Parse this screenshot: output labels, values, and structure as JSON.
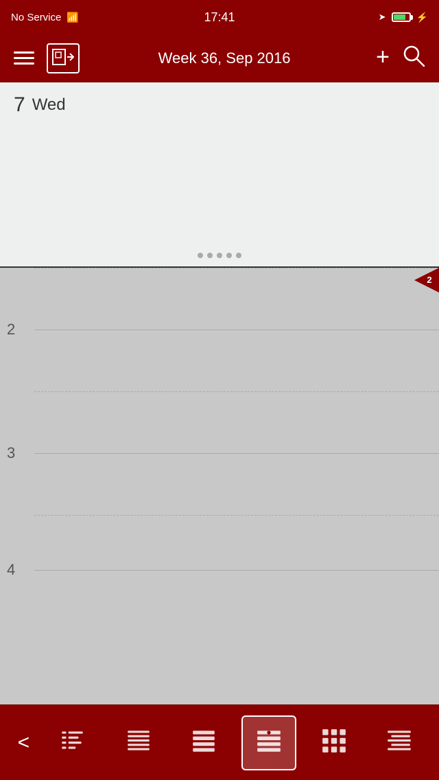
{
  "statusBar": {
    "carrier": "No Service",
    "time": "17:41"
  },
  "toolbar": {
    "weekLabel": "Week 36, Sep 2016",
    "addLabel": "+",
    "searchLabel": "🔍"
  },
  "allDay": {
    "dayNumber": "7",
    "dayName": "Wed"
  },
  "timeline": {
    "hours": [
      {
        "id": "hour-2",
        "label": "2"
      },
      {
        "id": "hour-3",
        "label": "3"
      },
      {
        "id": "hour-4",
        "label": "4"
      }
    ],
    "currentIndicator": "2"
  },
  "tabBar": {
    "backLabel": "<",
    "tabs": [
      {
        "id": "tab-timeline",
        "label": "Timeline"
      },
      {
        "id": "tab-list-compact",
        "label": "List Compact"
      },
      {
        "id": "tab-list",
        "label": "List"
      },
      {
        "id": "tab-week",
        "label": "Week",
        "active": true
      },
      {
        "id": "tab-month",
        "label": "Month"
      },
      {
        "id": "tab-agenda",
        "label": "Agenda"
      }
    ]
  }
}
